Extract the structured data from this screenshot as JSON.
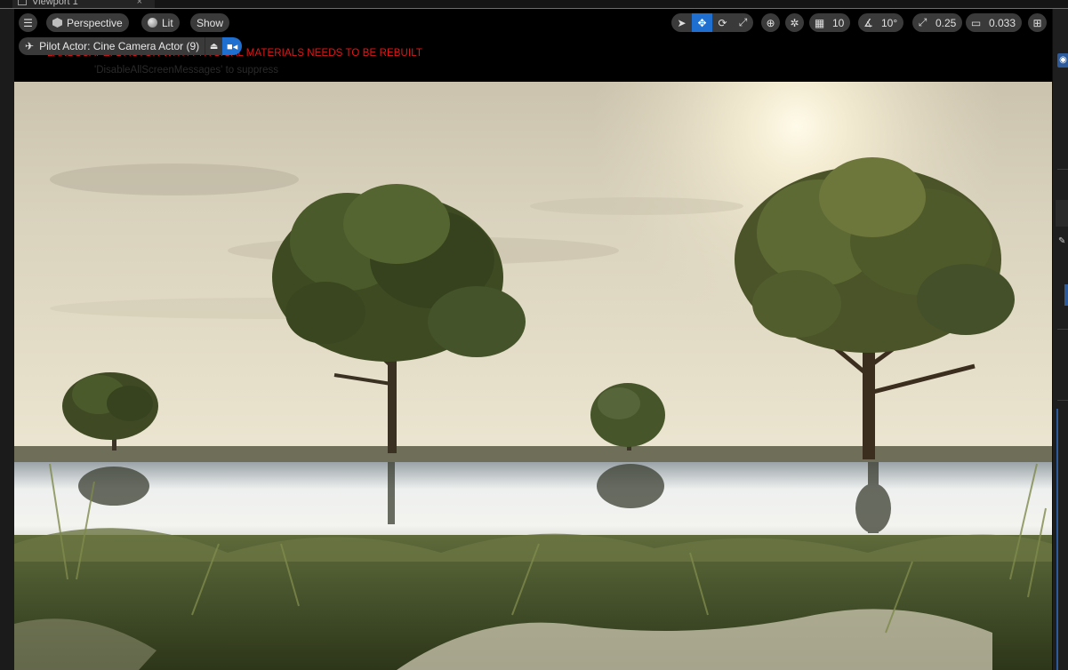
{
  "editor_tab": {
    "title": "Viewport 1",
    "close": "×"
  },
  "toolbar": {
    "menu_icon": "hamburger-icon",
    "view_mode": "Perspective",
    "lighting_mode": "Lit",
    "show_label": "Show",
    "transform_tools": [
      "select-icon",
      "translate-icon",
      "rotate-icon",
      "scale-icon"
    ],
    "active_tool": "translate-icon",
    "coordinate_space_icon": "globe-icon",
    "surface_snap_icon": "surface-snap-icon",
    "grid_snap_value": "10",
    "rotation_snap_value": "10°",
    "scale_snap_value": "0.25",
    "camera_speed_value": "0.033",
    "layout_icon": "viewport-layout-icon"
  },
  "pilot": {
    "label": "Pilot Actor: Cine Camera Actor (9)",
    "eject_icon": "eject-icon",
    "camera_icon": "camera-icon"
  },
  "messages": {
    "warning": "LANDSCAPE: 1 ACTOR WITH PHYSICAL MATERIALS NEEDS TO BE REBUILT",
    "hint": "'DisableAllScreenMessages' to suppress"
  },
  "colors": {
    "accent": "#1f6fd0",
    "warning": "#e01818",
    "toolbar_bg": "#3a3a3a",
    "viewport_bg": "#000000"
  }
}
